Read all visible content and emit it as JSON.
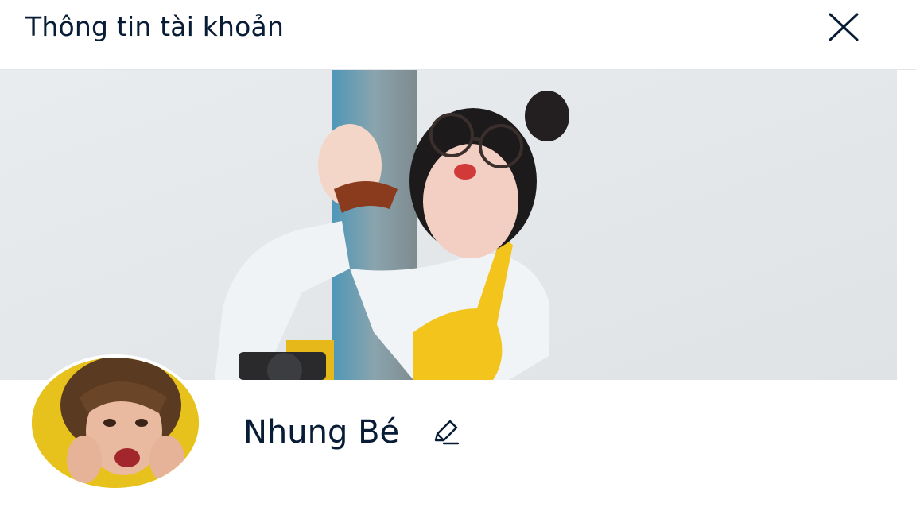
{
  "header": {
    "title": "Thông tin tài khoản",
    "close_icon": "close-icon"
  },
  "profile": {
    "display_name": "Nhung Bé",
    "edit_icon": "pencil-icon",
    "cover_photo": "cover-photo",
    "avatar_photo": "avatar-photo"
  },
  "colors": {
    "text_primary": "#081c36",
    "divider": "#e3e6ea",
    "background": "#ffffff"
  }
}
